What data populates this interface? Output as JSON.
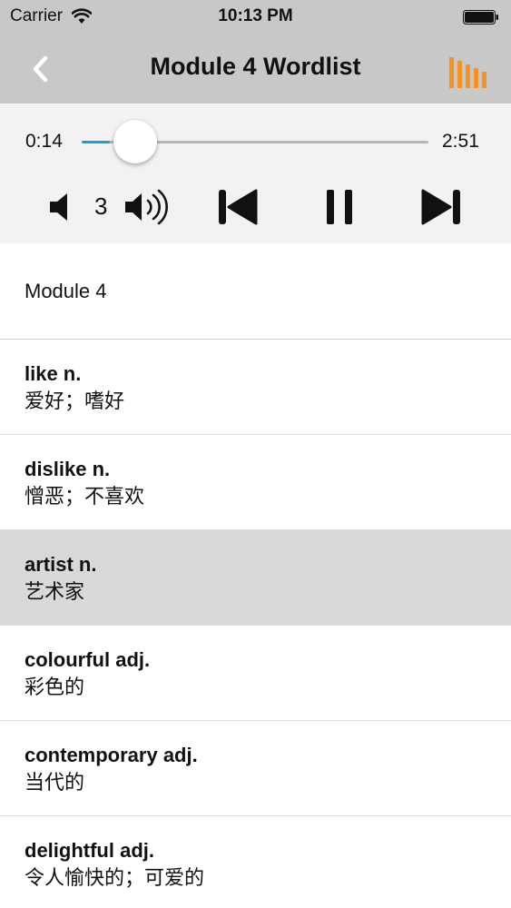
{
  "status_bar": {
    "carrier": "Carrier",
    "time": "10:13 PM",
    "wifi_icon": "wifi-icon",
    "battery_icon": "battery-icon"
  },
  "nav": {
    "title": "Module 4 Wordlist",
    "back_icon": "chevron-left-icon",
    "menu_icon": "bars-chart-icon",
    "accent_color": "#f7931e"
  },
  "player": {
    "elapsed": "0:14",
    "total": "2:51",
    "progress_fraction": 0.082,
    "volume_level": "3",
    "progress_color": "#1a9fe0",
    "controls": [
      "volume-down-icon",
      "volume-up-icon",
      "skip-previous-icon",
      "pause-icon",
      "skip-next-icon"
    ]
  },
  "list": {
    "header": "Module 4",
    "items": [
      {
        "word": "like n.",
        "meaning": "爱好；嗜好",
        "selected": false
      },
      {
        "word": "dislike n.",
        "meaning": "憎恶；不喜欢",
        "selected": false
      },
      {
        "word": "artist n.",
        "meaning": "艺术家",
        "selected": true
      },
      {
        "word": "colourful adj.",
        "meaning": "彩色的",
        "selected": false
      },
      {
        "word": "contemporary adj.",
        "meaning": "当代的",
        "selected": false
      },
      {
        "word": "delightful adj.",
        "meaning": "令人愉快的；可爱的",
        "selected": false
      }
    ]
  }
}
